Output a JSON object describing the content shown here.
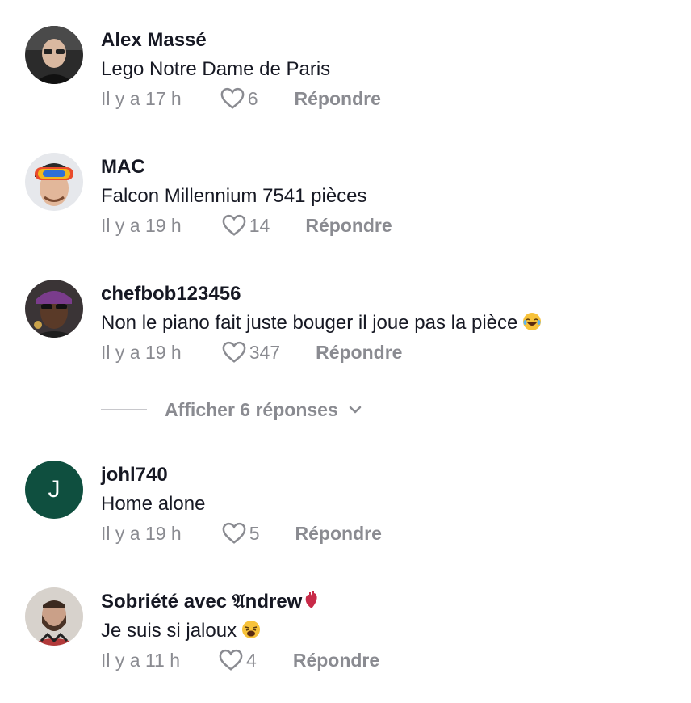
{
  "comments": [
    {
      "username": "Alex Massé",
      "text": "Lego Notre Dame de Paris",
      "time": "Il y a 17 h",
      "likes": "6",
      "reply": "Répondre",
      "avatar": "man-with-glasses"
    },
    {
      "username": "MAC",
      "text": "Falcon Millennium 7541 pièces",
      "time": "Il y a 19 h",
      "likes": "14",
      "reply": "Répondre",
      "avatar": "man-with-ski-goggles"
    },
    {
      "username": "chefbob123456",
      "text": "Non le piano fait juste bouger il joue pas la pièce",
      "emoji": "laughing-tears-emoji",
      "time": "Il y a 19 h",
      "likes": "347",
      "reply": "Répondre",
      "avatar": "man-with-sunglasses"
    },
    {
      "username": "johl740",
      "text": "Home alone",
      "time": "Il y a 19 h",
      "likes": "5",
      "reply": "Répondre",
      "avatar_letter": "J"
    },
    {
      "username": "Sobriété avec 𝔄ndrew",
      "username_badge": "anatomical-heart-emoji",
      "text": "Je suis si jaloux",
      "emoji": "weary-face-emoji",
      "time": "Il y a 11 h",
      "likes": "4",
      "reply": "Répondre",
      "avatar": "bearded-man-smiling"
    }
  ],
  "view_replies": {
    "label": "Afficher 6 réponses",
    "icon": "chevron-down-icon"
  },
  "colors": {
    "text": "#161823",
    "muted": "#8a8b91",
    "avatar_letter_bg": "#0f4f3f"
  }
}
